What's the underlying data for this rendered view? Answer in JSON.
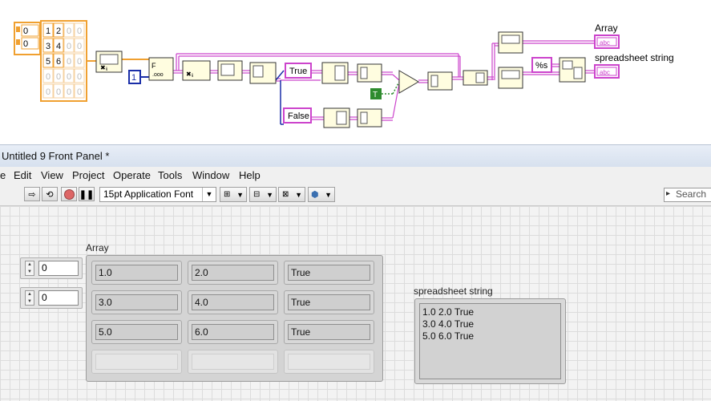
{
  "diagram": {
    "index_constants": [
      "0",
      "0"
    ],
    "array_constant": [
      [
        "1",
        "2",
        "0",
        "0"
      ],
      [
        "3",
        "4",
        "0",
        "0"
      ],
      [
        "5",
        "6",
        "0",
        "0"
      ],
      [
        "0",
        "0",
        "0",
        "0"
      ],
      [
        "0",
        "0",
        "0",
        "0"
      ]
    ],
    "numeric_constant": "1",
    "true_string": "True",
    "false_string": "False",
    "bool_constant": "T",
    "format_string": "%s",
    "array_indicator_label": "Array",
    "spreadsheet_indicator_label": "spreadsheet string",
    "string_icon_text": "abc",
    "colors": {
      "string_wire": "#cc44cc",
      "numeric_wire": "#f0a030",
      "int_wire": "#1a2ea8",
      "bool_wire": "#2e8b2e"
    }
  },
  "window": {
    "title": "Untitled 9 Front Panel *"
  },
  "menu": [
    "e",
    "Edit",
    "View",
    "Project",
    "Operate",
    "Tools",
    "Window",
    "Help"
  ],
  "toolbar": {
    "font": "15pt Application Font",
    "search_placeholder": "Search"
  },
  "panel": {
    "index_values": [
      "0",
      "0"
    ],
    "array_label": "Array",
    "array_cells": [
      [
        "1.0",
        "2.0",
        "True"
      ],
      [
        "3.0",
        "4.0",
        "True"
      ],
      [
        "5.0",
        "6.0",
        "True"
      ],
      [
        "",
        "",
        ""
      ]
    ],
    "spreadsheet_label": "spreadsheet string",
    "spreadsheet_lines": [
      "1.0 2.0 True",
      "3.0 4.0 True",
      "5.0 6.0 True"
    ]
  }
}
